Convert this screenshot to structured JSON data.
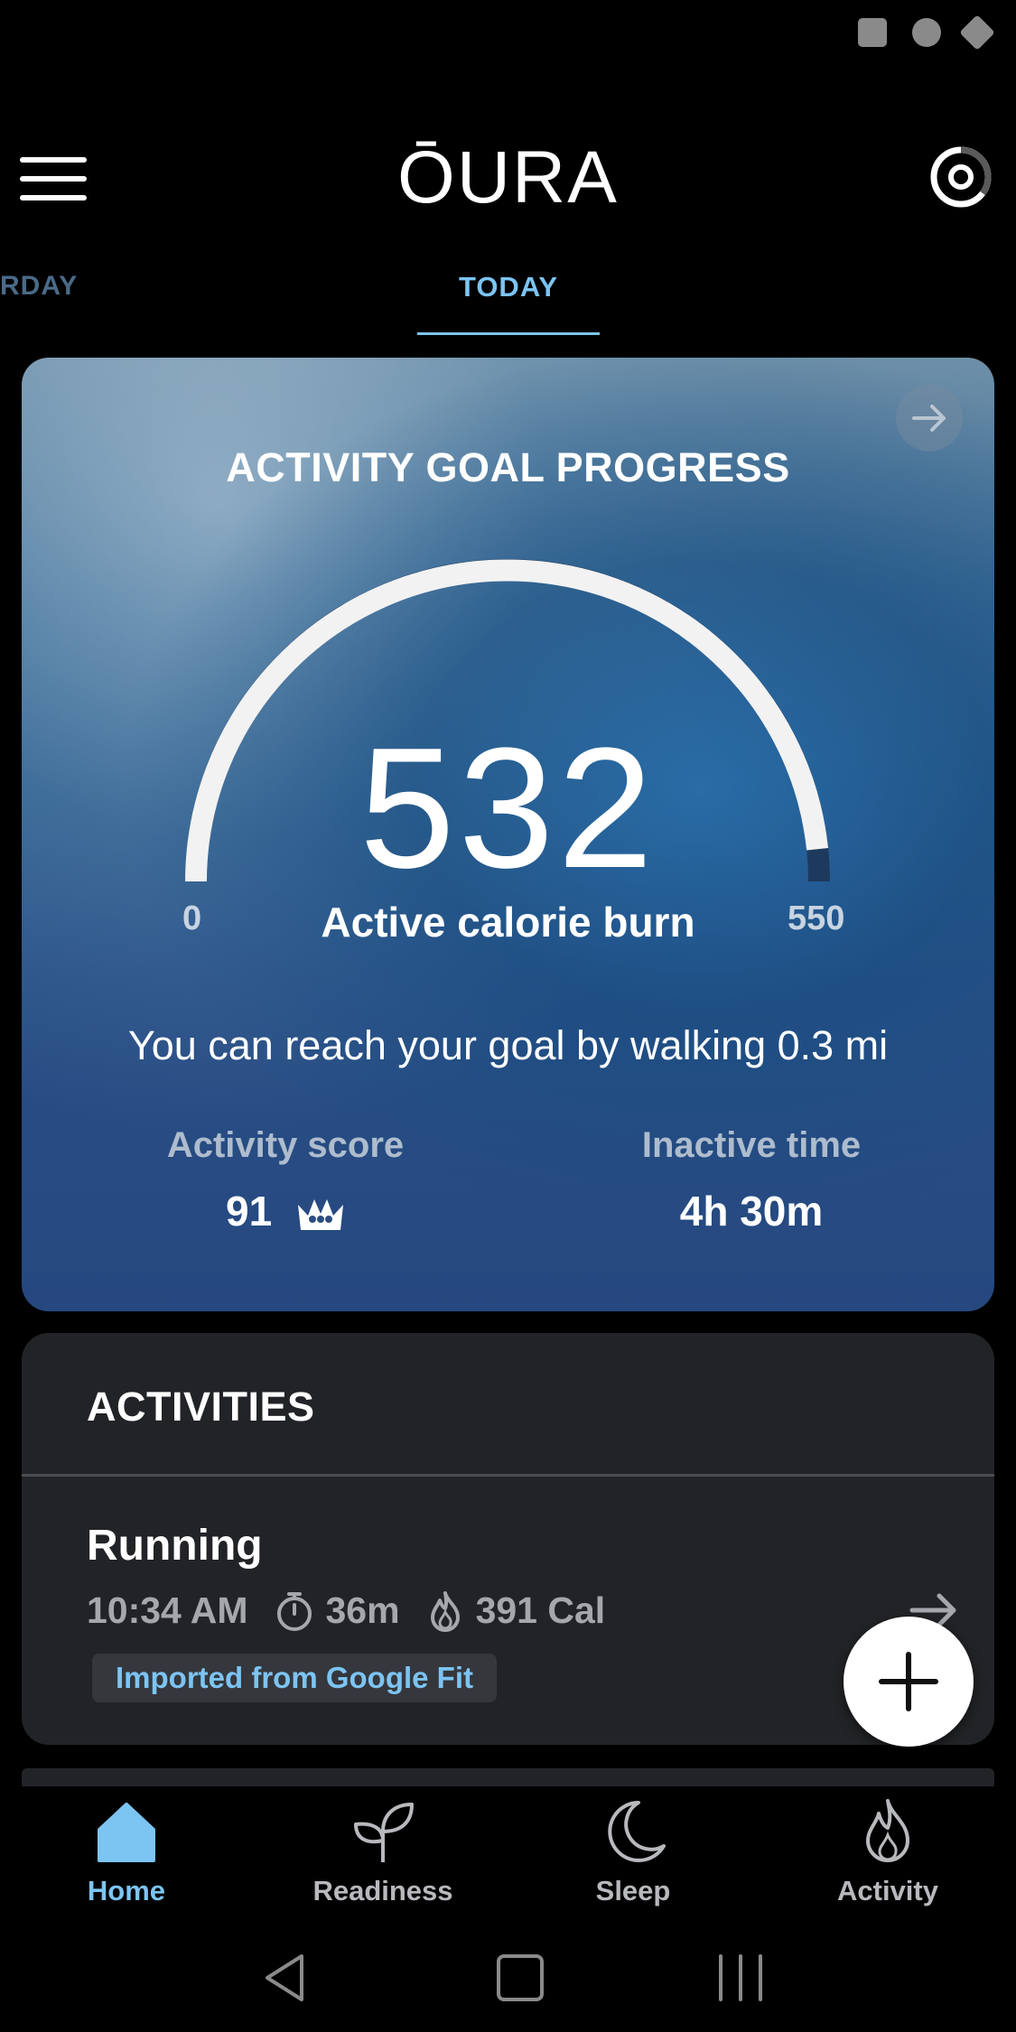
{
  "header": {
    "logo": "ŌURA"
  },
  "tabs": {
    "prev_label": "RDAY",
    "current_label": "TODAY"
  },
  "activity_goal": {
    "title": "ACTIVITY GOAL PROGRESS",
    "value": "532",
    "min_label": "0",
    "max_label": "550",
    "progress_fraction": 0.967,
    "metric_label": "Active calorie burn",
    "goal_message": "You can reach your goal by walking 0.3 mi",
    "activity_score_label": "Activity score",
    "activity_score_value": "91",
    "inactive_time_label": "Inactive time",
    "inactive_time_value": "4h 30m"
  },
  "activities": {
    "title": "ACTIVITIES",
    "items": [
      {
        "name": "Running",
        "time": "10:34 AM",
        "duration": "36m",
        "calories": "391 Cal",
        "source_badge": "Imported from Google Fit"
      }
    ]
  },
  "bottom_nav": {
    "items": [
      {
        "label": "Home",
        "icon": "home-icon",
        "active": true
      },
      {
        "label": "Readiness",
        "icon": "sprout-icon",
        "active": false
      },
      {
        "label": "Sleep",
        "icon": "moon-icon",
        "active": false
      },
      {
        "label": "Activity",
        "icon": "flame-icon",
        "active": false
      }
    ]
  },
  "colors": {
    "accent": "#7cc4f2",
    "card_dark": "#222326",
    "background": "#000000"
  }
}
